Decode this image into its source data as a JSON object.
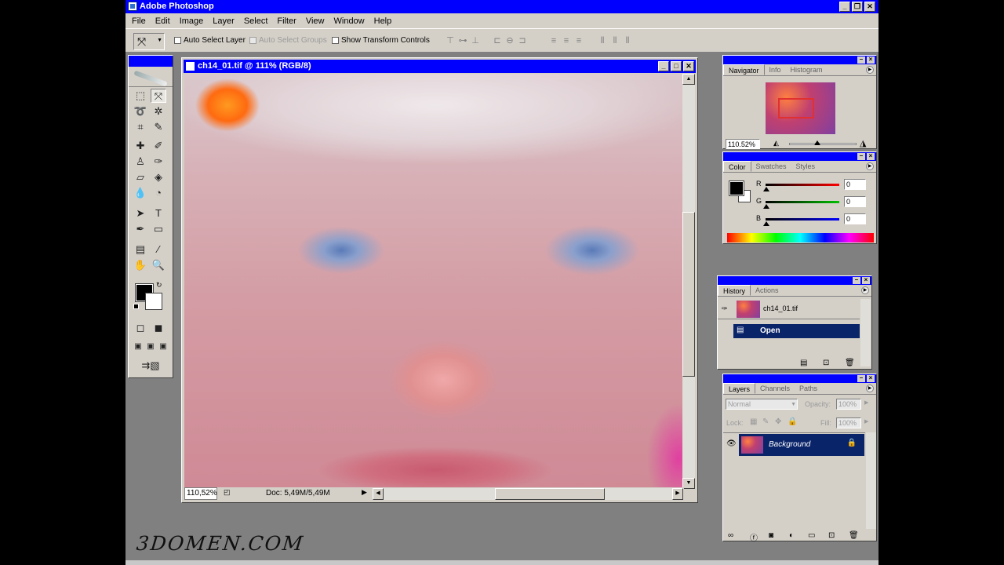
{
  "app": {
    "title": "Adobe Photoshop"
  },
  "menu": [
    "File",
    "Edit",
    "Image",
    "Layer",
    "Select",
    "Filter",
    "View",
    "Window",
    "Help"
  ],
  "options": {
    "auto_select_layer": "Auto Select Layer",
    "auto_select_groups": "Auto Select Groups",
    "show_transform_controls": "Show Transform Controls"
  },
  "document": {
    "title": "ch14_01.tif @ 111% (RGB/8)",
    "zoom": "110,52%",
    "doc_info": "Doc: 5,49M/5,49M"
  },
  "navigator": {
    "tabs": [
      "Navigator",
      "Info",
      "Histogram"
    ],
    "zoom": "110.52%"
  },
  "color": {
    "tabs": [
      "Color",
      "Swatches",
      "Styles"
    ],
    "channels": [
      {
        "label": "R",
        "value": "0",
        "color": "#ff0000"
      },
      {
        "label": "G",
        "value": "0",
        "color": "#00c000"
      },
      {
        "label": "B",
        "value": "0",
        "color": "#0000ff"
      }
    ],
    "foreground": "#000000",
    "background": "#ffffff"
  },
  "history": {
    "tabs": [
      "History",
      "Actions"
    ],
    "snapshot": "ch14_01.tif",
    "items": [
      "Open"
    ]
  },
  "layers": {
    "tabs": [
      "Layers",
      "Channels",
      "Paths"
    ],
    "blend_mode": "Normal",
    "opacity_label": "Opacity:",
    "opacity": "100%",
    "lock_label": "Lock:",
    "fill_label": "Fill:",
    "fill": "100%",
    "items": [
      "Background"
    ]
  },
  "watermark": "3DOMEN.COM"
}
